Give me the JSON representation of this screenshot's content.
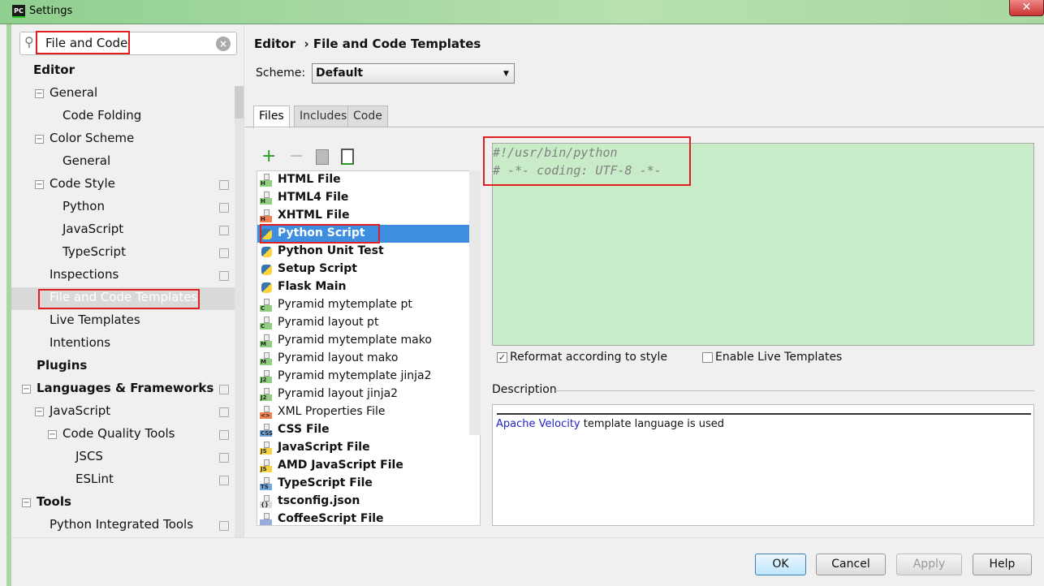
{
  "window": {
    "title": "Settings",
    "app_icon": "PC",
    "close": "✕"
  },
  "search": {
    "value": "File and Code",
    "icon": "search-icon",
    "clear": "×"
  },
  "sidebar": {
    "items": [
      {
        "label": "Editor",
        "bold": true,
        "x": 41,
        "tog": false,
        "copy": false
      },
      {
        "label": "General",
        "bold": false,
        "x": 61,
        "tog": true,
        "copy": false
      },
      {
        "label": "Code Folding",
        "bold": false,
        "x": 77,
        "tog": false,
        "copy": false
      },
      {
        "label": "Color Scheme",
        "bold": false,
        "x": 61,
        "tog": true,
        "copy": false
      },
      {
        "label": "General",
        "bold": false,
        "x": 77,
        "tog": false,
        "copy": false
      },
      {
        "label": "Code Style",
        "bold": false,
        "x": 61,
        "tog": true,
        "copy": true
      },
      {
        "label": "Python",
        "bold": false,
        "x": 77,
        "tog": false,
        "copy": true
      },
      {
        "label": "JavaScript",
        "bold": false,
        "x": 77,
        "tog": false,
        "copy": true
      },
      {
        "label": "TypeScript",
        "bold": false,
        "x": 77,
        "tog": false,
        "copy": true
      },
      {
        "label": "Inspections",
        "bold": false,
        "x": 61,
        "tog": false,
        "copy": true
      },
      {
        "label": "File and Code Templates",
        "bold": false,
        "x": 61,
        "tog": false,
        "copy": false,
        "selected": true
      },
      {
        "label": "Live Templates",
        "bold": false,
        "x": 61,
        "tog": false,
        "copy": false
      },
      {
        "label": "Intentions",
        "bold": false,
        "x": 61,
        "tog": false,
        "copy": false
      },
      {
        "label": "Plugins",
        "bold": true,
        "x": 45,
        "tog": false,
        "copy": false
      },
      {
        "label": "Languages & Frameworks",
        "bold": true,
        "x": 45,
        "tog": true,
        "copy": true
      },
      {
        "label": "JavaScript",
        "bold": false,
        "x": 61,
        "tog": true,
        "copy": true
      },
      {
        "label": "Code Quality Tools",
        "bold": false,
        "x": 77,
        "tog": true,
        "copy": true
      },
      {
        "label": "JSCS",
        "bold": false,
        "x": 93,
        "tog": false,
        "copy": true
      },
      {
        "label": "ESLint",
        "bold": false,
        "x": 93,
        "tog": false,
        "copy": true
      },
      {
        "label": "Tools",
        "bold": true,
        "x": 45,
        "tog": true,
        "copy": false
      },
      {
        "label": "Python Integrated Tools",
        "bold": false,
        "x": 61,
        "tog": false,
        "copy": true
      }
    ]
  },
  "breadcrumb": {
    "parent": "Editor",
    "sep": "›",
    "current": "File and Code Templates"
  },
  "scheme": {
    "label": "Scheme:",
    "value": "Default"
  },
  "tabs": [
    {
      "label": "Files",
      "active": true
    },
    {
      "label": "Includes",
      "active": false
    },
    {
      "label": "Code",
      "active": false
    }
  ],
  "toolbar": {
    "add": "+",
    "remove": "−"
  },
  "templates": [
    {
      "label": "HTML File",
      "bold": true,
      "icon": "H",
      "color": "#8fcf7f"
    },
    {
      "label": "HTML4 File",
      "bold": true,
      "icon": "H",
      "color": "#8fcf7f"
    },
    {
      "label": "XHTML File",
      "bold": true,
      "icon": "H",
      "color": "#f08050"
    },
    {
      "label": "Python Script",
      "bold": true,
      "icon": "py",
      "selected": true
    },
    {
      "label": "Python Unit Test",
      "bold": true,
      "icon": "py"
    },
    {
      "label": "Setup Script",
      "bold": true,
      "icon": "py"
    },
    {
      "label": "Flask Main",
      "bold": true,
      "icon": "py"
    },
    {
      "label": "Pyramid mytemplate pt",
      "bold": false,
      "icon": "C",
      "color": "#8fcf7f"
    },
    {
      "label": "Pyramid layout pt",
      "bold": false,
      "icon": "C",
      "color": "#8fcf7f"
    },
    {
      "label": "Pyramid mytemplate mako",
      "bold": false,
      "icon": "M",
      "color": "#8fcf7f"
    },
    {
      "label": "Pyramid layout mako",
      "bold": false,
      "icon": "M",
      "color": "#8fcf7f"
    },
    {
      "label": "Pyramid mytemplate jinja2",
      "bold": false,
      "icon": "J2",
      "color": "#8fcf7f"
    },
    {
      "label": "Pyramid layout jinja2",
      "bold": false,
      "icon": "J2",
      "color": "#8fcf7f"
    },
    {
      "label": "XML Properties File",
      "bold": false,
      "icon": "<>",
      "color": "#f08050"
    },
    {
      "label": "CSS File",
      "bold": true,
      "icon": "CSS",
      "color": "#6fa8dc"
    },
    {
      "label": "JavaScript File",
      "bold": true,
      "icon": "JS",
      "color": "#f5d442"
    },
    {
      "label": "AMD JavaScript File",
      "bold": true,
      "icon": "JS",
      "color": "#f5d442"
    },
    {
      "label": "TypeScript File",
      "bold": true,
      "icon": "TS",
      "color": "#6fa8dc"
    },
    {
      "label": "tsconfig.json",
      "bold": true,
      "icon": "{}",
      "color": "#dddddd"
    },
    {
      "label": "CoffeeScript File",
      "bold": true,
      "icon": "",
      "color": "#9ad"
    }
  ],
  "editor": {
    "lines": [
      "#!/usr/bin/python",
      "# -*- coding: UTF-8 -*-"
    ]
  },
  "options": {
    "reformat": {
      "label": "Reformat according to style",
      "checked": true
    },
    "live": {
      "label": "Enable Live Templates",
      "checked": false
    }
  },
  "description": {
    "label": "Description",
    "link": "Apache Velocity",
    "text": " template language is used"
  },
  "buttons": {
    "ok": "OK",
    "cancel": "Cancel",
    "apply": "Apply",
    "help": "Help"
  },
  "colors": {
    "highlight": "#e02020",
    "selection": "#3d8ee0",
    "editor_bg": "#c8ebc8"
  }
}
